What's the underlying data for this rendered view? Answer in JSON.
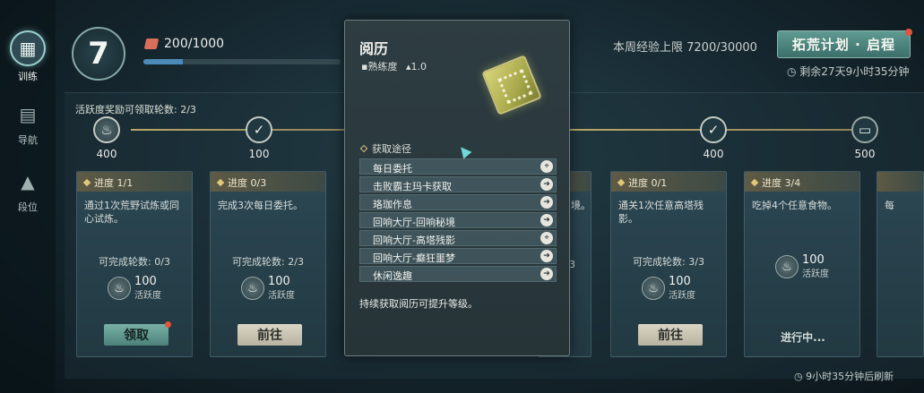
{
  "nav": {
    "items": [
      {
        "label": "训练",
        "icon": "calendar-icon",
        "active": true
      },
      {
        "label": "导航",
        "icon": "book-search-icon",
        "active": false
      },
      {
        "label": "段位",
        "icon": "rank-icon",
        "active": false
      }
    ]
  },
  "header": {
    "level": "7",
    "exp_text": "200/1000",
    "exp_progress": 0.2,
    "week_cap": "本周经验上限 7200/30000",
    "plan_button": "拓荒计划 · 启程",
    "plan_time": "剩余27天9小时35分钟"
  },
  "activity": {
    "label": "活跃度奖励可领取轮数: 2/3",
    "milestones": [
      {
        "value": "400",
        "icon": "flame-icon",
        "claimed": false
      },
      {
        "value": "100",
        "icon": "check-icon",
        "claimed": true
      },
      {
        "value": "400",
        "icon": "check-icon",
        "claimed": true
      },
      {
        "value": "500",
        "icon": "chest-icon",
        "claimed": false
      }
    ]
  },
  "tasks": [
    {
      "progress": "进度 1/1",
      "desc": "通过1次荒野试炼或同心试炼。",
      "rounds": "可完成轮数: 0/3",
      "reward": "100",
      "reward_label": "活跃度",
      "button": "领取",
      "button_style": "teal",
      "has_dot": true
    },
    {
      "progress": "进度 0/3",
      "desc": "完成3次每日委托。",
      "rounds": "可完成轮数: 2/3",
      "reward": "100",
      "reward_label": "活跃度",
      "button": "前往",
      "button_style": "light",
      "has_dot": false
    },
    {
      "progress": "进度 0/1",
      "desc": "通关1次任意高塔残影。",
      "rounds": "可完成轮数: 3/3",
      "reward": "100",
      "reward_label": "活跃度",
      "button": "前往",
      "button_style": "light",
      "has_dot": false
    },
    {
      "progress": "进度 3/4",
      "desc": "吃掉4个任意食物。",
      "rounds": "",
      "reward": "100",
      "reward_label": "活跃度",
      "status": "进行中..."
    }
  ],
  "partial": {
    "desc_tail": "境。",
    "extra_char": "每",
    "rounds_tail": "3"
  },
  "refresh": "9小时35分钟后刷新",
  "tooltip": {
    "title": "阅历",
    "proficiency_label": "熟练度",
    "value": "1.0",
    "source_header": "获取途径",
    "sources": [
      {
        "label": "每日委托",
        "icon": "location-icon"
      },
      {
        "label": "击败霸主玛卡获取",
        "icon": "arrow-icon"
      },
      {
        "label": "珞珈作息",
        "icon": "arrow-icon"
      },
      {
        "label": "回响大厅-回响秘境",
        "icon": "arrow-icon"
      },
      {
        "label": "回响大厅-高塔残影",
        "icon": "location-icon"
      },
      {
        "label": "回响大厅-癫狂噩梦",
        "icon": "arrow-icon"
      },
      {
        "label": "休闲逸趣",
        "icon": "arrow-icon"
      }
    ],
    "note": "持续获取阅历可提升等级。"
  },
  "colors": {
    "accent": "#4c8ab8",
    "gold": "#e1c878",
    "dot": "#e2553a"
  }
}
